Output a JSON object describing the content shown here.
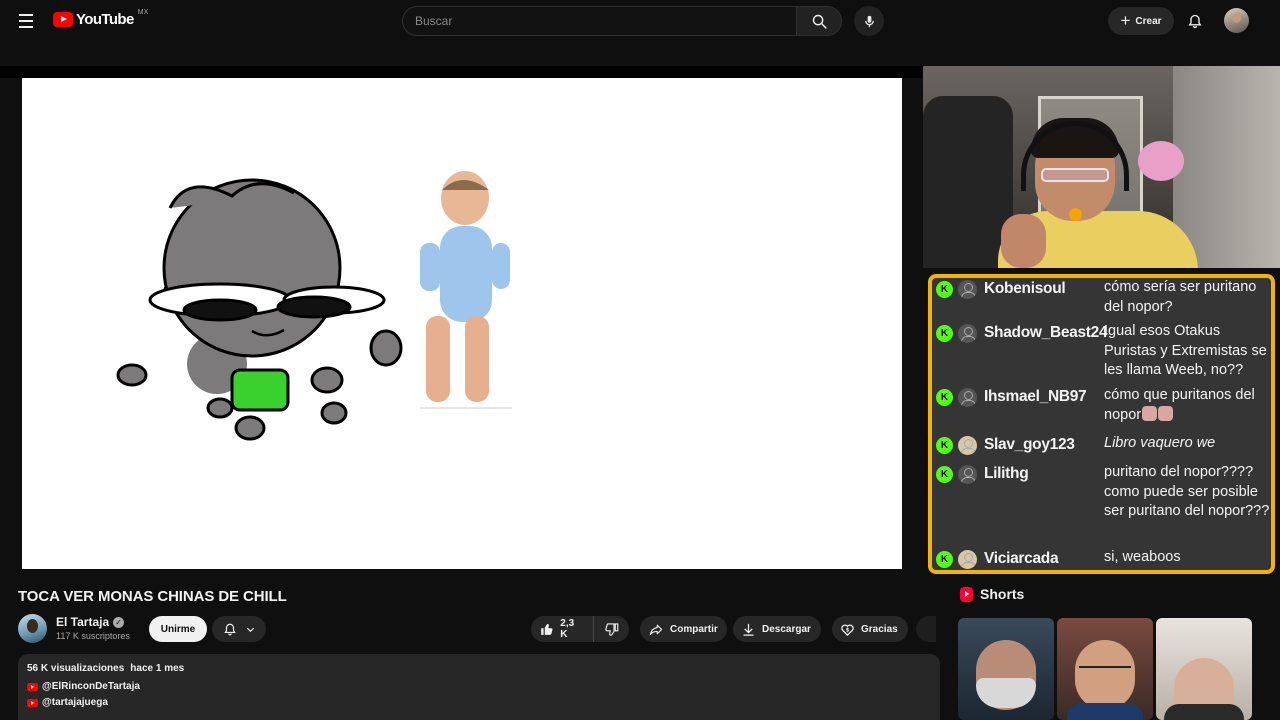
{
  "header": {
    "logo_text": "YouTube",
    "country_code": "MX",
    "search_placeholder": "Buscar",
    "create_label": "Crear"
  },
  "video": {
    "title": "TOCA VER MONAS CHINAS DE CHILL",
    "channel_name": "El Tartaja",
    "subscribers": "117 K suscriptores",
    "join_label": "Unirme",
    "like_count": "2,3 K",
    "share_label": "Compartir",
    "download_label": "Descargar",
    "thanks_label": "Gracias"
  },
  "description": {
    "views": "56 K visualizaciones",
    "date": "hace 1 mes",
    "links": [
      "@ElRinconDeTartaja",
      "@tartajajuega"
    ]
  },
  "stream_chat": {
    "border_color": "#f2b400",
    "badge_color": "#53fc18",
    "badge_letter": "K",
    "messages": [
      {
        "user": "Kobenisoul",
        "text": "cómo sería ser puritano del nopor?"
      },
      {
        "user": "Shadow_Beast24",
        "text": "Igual esos Otakus Puristas y Extremistas se les llama Weeb, no??"
      },
      {
        "user": "Ihsmael_NB97",
        "text": "cómo que puritanos del nopor"
      },
      {
        "user": "Slav_goy123",
        "text": "Libro vaquero we"
      },
      {
        "user": "Lilithg",
        "text": "puritano del nopor???? como puede ser posible ser puritano del nopor???"
      },
      {
        "user": "Viciarcada",
        "text": "si, weaboos"
      }
    ]
  },
  "shorts": {
    "title": "Shorts"
  }
}
